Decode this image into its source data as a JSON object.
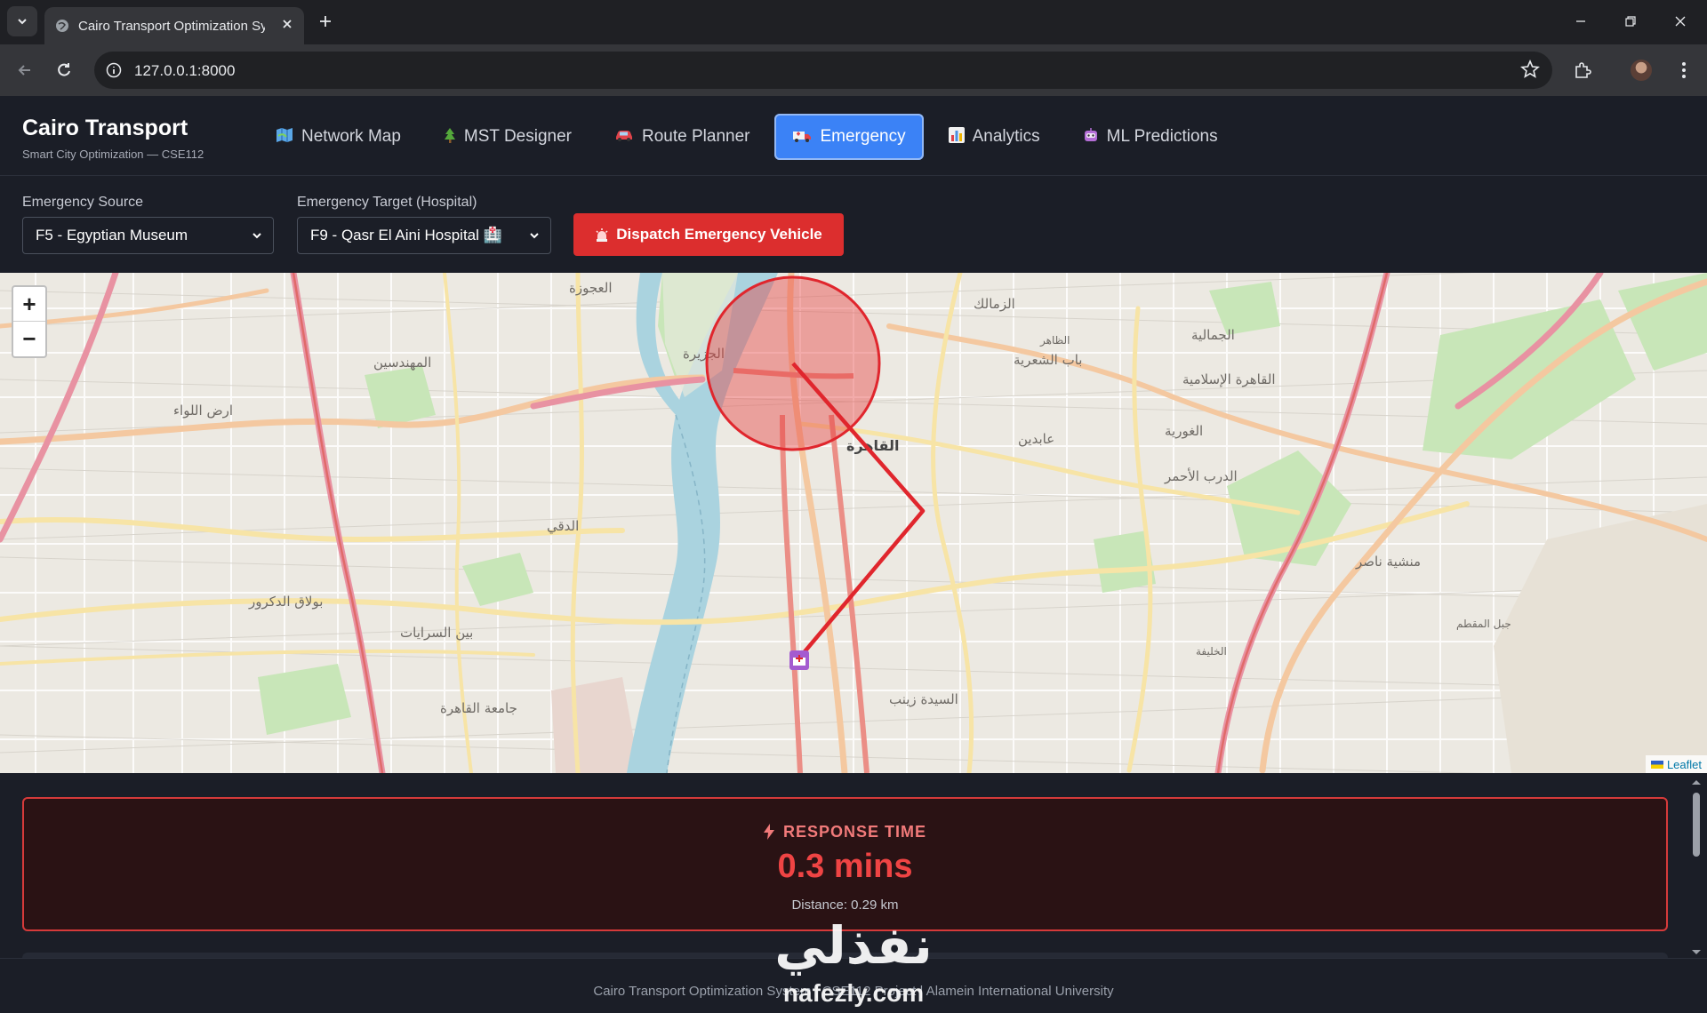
{
  "browser": {
    "tab_title": "Cairo Transport Optimization Sy",
    "url": "127.0.0.1:8000"
  },
  "header": {
    "title": "Cairo Transport",
    "subtitle": "Smart City Optimization — CSE112",
    "tabs": [
      {
        "label": "Network Map",
        "icon": "map-icon",
        "active": false
      },
      {
        "label": "MST Designer",
        "icon": "tree-icon",
        "active": false
      },
      {
        "label": "Route Planner",
        "icon": "car-icon",
        "active": false
      },
      {
        "label": "Emergency",
        "icon": "ambulance-icon",
        "active": true
      },
      {
        "label": "Analytics",
        "icon": "bar-chart-icon",
        "active": false
      },
      {
        "label": "ML Predictions",
        "icon": "robot-icon",
        "active": false
      }
    ]
  },
  "controls": {
    "source_label": "Emergency Source",
    "source_value": "F5 - Egyptian Museum",
    "target_label": "Emergency Target (Hospital)",
    "target_value": "F9 - Qasr El Aini Hospital 🏥",
    "dispatch_label": "Dispatch Emergency Vehicle"
  },
  "map": {
    "zoom_in": "+",
    "zoom_out": "−",
    "attribution": "Leaflet",
    "labels": {
      "a1": "العجوزة",
      "a2": "المهندسين",
      "a3": "ارض اللواء",
      "a4": "الزمالك",
      "a5": "الجزيرة",
      "a6": "القاهرة",
      "a7": "عابدين",
      "a8": "باب الشعرية",
      "a9": "الجمالية",
      "a10": "القاهرة الإسلامية",
      "a11": "الغورية",
      "a12": "الدرب الأحمر",
      "a13": "منشية ناصر",
      "a14": "جبل المقطم",
      "a15": "الخليفة",
      "a16": "السيدة زينب",
      "a17": "بين السرايات",
      "a18": "بولاق الدكرور",
      "a19": "جامعة القاهرة",
      "a20": "الدقي",
      "a21": "الظاهر"
    }
  },
  "results": {
    "title": "RESPONSE TIME",
    "value": "0.3 mins",
    "distance": "Distance: 0.29 km"
  },
  "footer": {
    "text": "Cairo Transport Optimization System | CSE112 Project | Alamein International University"
  },
  "watermark": {
    "arabic": "نفذلي",
    "latin": "nafezly.com"
  },
  "colors": {
    "accent": "#3b82f6",
    "danger": "#dc2e2e",
    "background": "#1b1e27",
    "route": "#e0262d"
  }
}
